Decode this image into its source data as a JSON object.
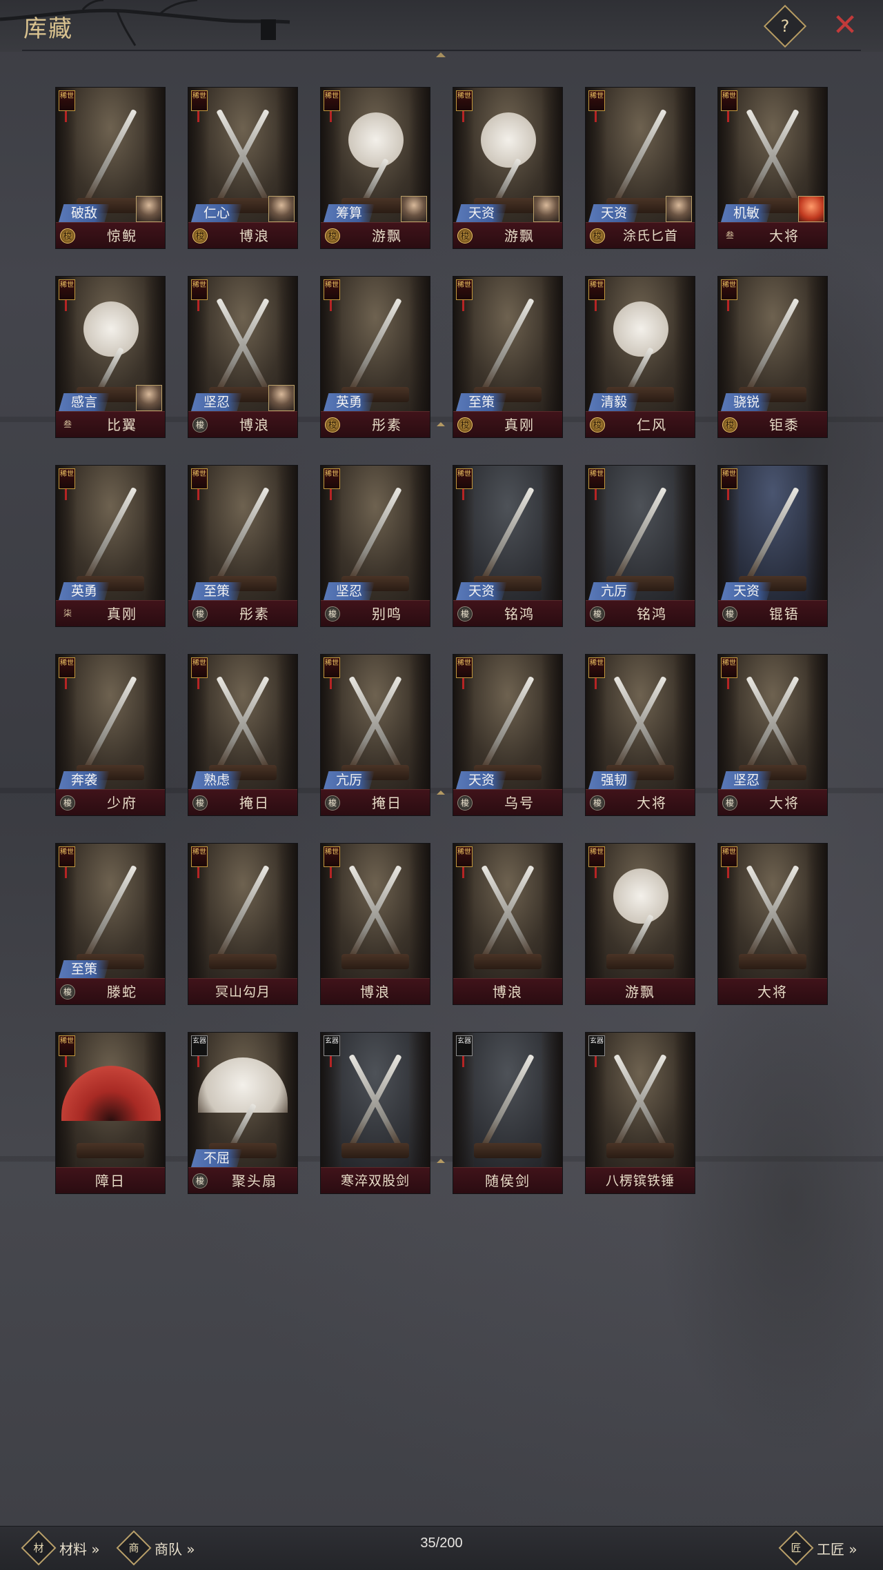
{
  "header": {
    "title": "库藏",
    "help_label": "?",
    "close_label": "✕"
  },
  "rarity_badge": "稀世",
  "rarity_badge_black": "玄器",
  "items": [
    {
      "name": "惊鲵",
      "skill": "破敌",
      "emblem": "梭",
      "emblem_style": "gold",
      "art": "spear",
      "avatar": true,
      "rare": "gold"
    },
    {
      "name": "博浪",
      "skill": "仁心",
      "emblem": "梭",
      "emblem_style": "gold",
      "art": "hammers",
      "avatar": true,
      "rare": "gold"
    },
    {
      "name": "游飘",
      "skill": "筹算",
      "emblem": "梭",
      "emblem_style": "gold",
      "art": "fan",
      "avatar": true,
      "rare": "gold"
    },
    {
      "name": "游飘",
      "skill": "天资",
      "emblem": "梭",
      "emblem_style": "gold",
      "art": "fan",
      "avatar": true,
      "rare": "gold"
    },
    {
      "name": "涂氏匕首",
      "skill": "天资",
      "emblem": "梭",
      "emblem_style": "gold",
      "art": "dagger",
      "avatar": true,
      "rare": "gold"
    },
    {
      "name": "大将",
      "skill": "机敏",
      "emblem": "叁",
      "emblem_style": "flat",
      "art": "crossed",
      "avatar": "red",
      "rare": "gold"
    },
    {
      "name": "比翼",
      "skill": "感言",
      "emblem": "叁",
      "emblem_style": "flat",
      "art": "roundfan",
      "avatar": true,
      "rare": "gold"
    },
    {
      "name": "博浪",
      "skill": "坚忍",
      "emblem": "梭",
      "emblem_style": "grey",
      "art": "hammers",
      "avatar": true,
      "rare": "gold"
    },
    {
      "name": "彤素",
      "skill": "英勇",
      "emblem": "梭",
      "emblem_style": "gold",
      "art": "bow",
      "avatar": false,
      "rare": "gold"
    },
    {
      "name": "真刚",
      "skill": "至策",
      "emblem": "梭",
      "emblem_style": "gold",
      "art": "axe",
      "avatar": false,
      "rare": "gold"
    },
    {
      "name": "仁风",
      "skill": "清毅",
      "emblem": "梭",
      "emblem_style": "gold",
      "art": "fan",
      "avatar": false,
      "rare": "gold"
    },
    {
      "name": "钜黍",
      "skill": "骁锐",
      "emblem": "梭",
      "emblem_style": "gold",
      "art": "bow",
      "avatar": false,
      "rare": "gold"
    },
    {
      "name": "真刚",
      "skill": "英勇",
      "emblem": "柒",
      "emblem_style": "flat",
      "art": "axe",
      "avatar": false,
      "rare": "gold"
    },
    {
      "name": "彤素",
      "skill": "至策",
      "emblem": "梭",
      "emblem_style": "grey",
      "art": "bow",
      "avatar": false,
      "rare": "gold"
    },
    {
      "name": "别鸣",
      "skill": "坚忍",
      "emblem": "梭",
      "emblem_style": "grey",
      "art": "dagger",
      "avatar": false,
      "rare": "gold"
    },
    {
      "name": "铭鸿",
      "skill": "天资",
      "emblem": "梭",
      "emblem_style": "grey",
      "art": "sword",
      "avatar": false,
      "rare": "gold"
    },
    {
      "name": "铭鸿",
      "skill": "亢厉",
      "emblem": "梭",
      "emblem_style": "grey",
      "art": "sword",
      "avatar": false,
      "rare": "gold"
    },
    {
      "name": "锟铻",
      "skill": "天资",
      "emblem": "梭",
      "emblem_style": "grey",
      "art": "night",
      "avatar": false,
      "rare": "gold"
    },
    {
      "name": "少府",
      "skill": "奔袭",
      "emblem": "梭",
      "emblem_style": "grey",
      "art": "crossbow",
      "avatar": false,
      "rare": "gold"
    },
    {
      "name": "掩日",
      "skill": "熟虑",
      "emblem": "梭",
      "emblem_style": "grey",
      "art": "halberd",
      "avatar": false,
      "rare": "gold"
    },
    {
      "name": "掩日",
      "skill": "亢厉",
      "emblem": "梭",
      "emblem_style": "grey",
      "art": "halberd",
      "avatar": false,
      "rare": "gold"
    },
    {
      "name": "乌号",
      "skill": "天资",
      "emblem": "梭",
      "emblem_style": "grey",
      "art": "bow",
      "avatar": false,
      "rare": "gold"
    },
    {
      "name": "大将",
      "skill": "强韧",
      "emblem": "梭",
      "emblem_style": "grey",
      "art": "crossed",
      "avatar": false,
      "rare": "gold"
    },
    {
      "name": "大将",
      "skill": "坚忍",
      "emblem": "梭",
      "emblem_style": "grey",
      "art": "crossed",
      "avatar": false,
      "rare": "gold"
    },
    {
      "name": "滕蛇",
      "skill": "至策",
      "emblem": "梭",
      "emblem_style": "grey",
      "art": "spear",
      "avatar": false,
      "rare": "gold"
    },
    {
      "name": "冥山勾月",
      "skill": "",
      "emblem": "",
      "emblem_style": "none",
      "art": "spear",
      "avatar": false,
      "rare": "gold"
    },
    {
      "name": "博浪",
      "skill": "",
      "emblem": "",
      "emblem_style": "none",
      "art": "hammers",
      "avatar": false,
      "rare": "gold"
    },
    {
      "name": "博浪",
      "skill": "",
      "emblem": "",
      "emblem_style": "none",
      "art": "hammers",
      "avatar": false,
      "rare": "gold"
    },
    {
      "name": "游飘",
      "skill": "",
      "emblem": "",
      "emblem_style": "none",
      "art": "fan",
      "avatar": false,
      "rare": "gold"
    },
    {
      "name": "大将",
      "skill": "",
      "emblem": "",
      "emblem_style": "none",
      "art": "crossed",
      "avatar": false,
      "rare": "gold"
    },
    {
      "name": "障日",
      "skill": "",
      "emblem": "",
      "emblem_style": "none",
      "art": "redfan",
      "avatar": false,
      "rare": "gold"
    },
    {
      "name": "聚头扇",
      "skill": "不屈",
      "emblem": "梭",
      "emblem_style": "grey",
      "art": "whitefan",
      "avatar": false,
      "rare": "black"
    },
    {
      "name": "寒淬双股剑",
      "skill": "",
      "emblem": "",
      "emblem_style": "none",
      "art": "twinswords",
      "avatar": false,
      "rare": "black"
    },
    {
      "name": "随侯剑",
      "skill": "",
      "emblem": "",
      "emblem_style": "none",
      "art": "sword",
      "avatar": false,
      "rare": "black"
    },
    {
      "name": "八楞镔铁锤",
      "skill": "",
      "emblem": "",
      "emblem_style": "none",
      "art": "hammers",
      "avatar": false,
      "rare": "black"
    }
  ],
  "footer": {
    "materials_label": "材料 »",
    "materials_icon": "材",
    "caravan_label": "商队 »",
    "caravan_icon": "商",
    "count": "35/200",
    "craftsman_label": "工匠 »",
    "craftsman_icon": "匠"
  },
  "colors": {
    "accent_gold": "#d9c28f",
    "close_red": "#c23a3a",
    "skill_blue": "#4a6aac",
    "namebar": "#3a1118"
  }
}
